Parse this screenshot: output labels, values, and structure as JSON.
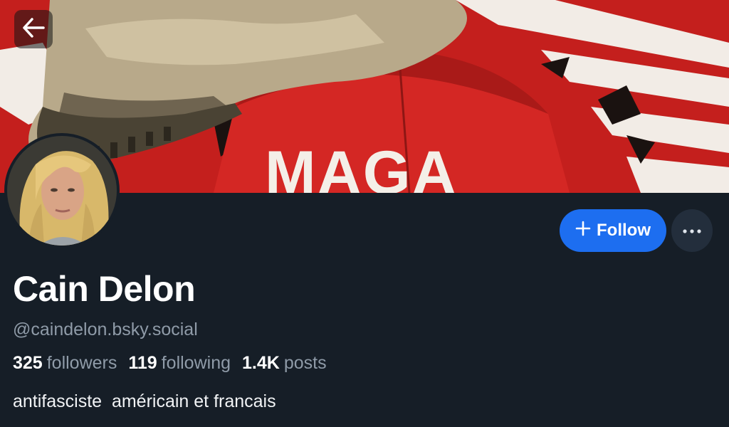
{
  "banner": {
    "cap_text": "MAGA"
  },
  "profile": {
    "display_name": "Cain Delon",
    "handle": "@caindelon.bsky.social",
    "stats": [
      {
        "count": "325",
        "label": "followers"
      },
      {
        "count": "119",
        "label": "following"
      },
      {
        "count": "1.4K",
        "label": "posts"
      }
    ],
    "bio": "antifasciste  américain et francais"
  },
  "actions": {
    "follow_label": "Follow",
    "more_icon": "ellipsis-icon",
    "back_icon": "arrow-left-icon"
  },
  "colors": {
    "accent": "#1d6ef0",
    "background": "#161e27",
    "muted_text": "#8f9ba8"
  }
}
